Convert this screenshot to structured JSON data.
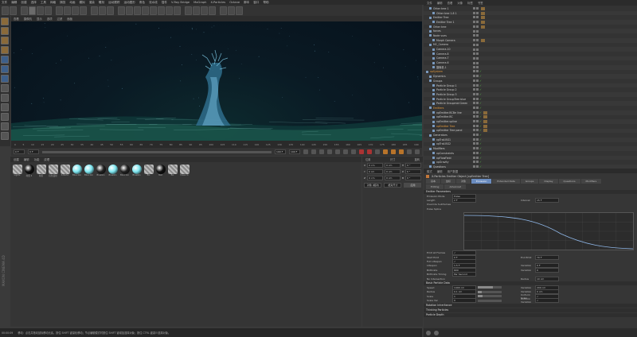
{
  "menubar": [
    "文件",
    "编辑",
    "创建",
    "选择",
    "工具",
    "网格",
    "捕捉",
    "动画",
    "模拟",
    "渲染",
    "雕刻",
    "运动跟踪",
    "运动图形",
    "角色",
    "流水线",
    "插件",
    "V-Ray Bridge",
    "MoGraph",
    "X-Particles",
    "Octane",
    "脚本",
    "窗口",
    "帮助"
  ],
  "layout_label": "界面",
  "viewport": {
    "menu": [
      "查看",
      "摄像机",
      "显示",
      "选项",
      "过滤",
      "面板"
    ]
  },
  "timeline": {
    "ticks": [
      "0",
      "5",
      "10",
      "15",
      "20",
      "25",
      "30",
      "35",
      "40",
      "45",
      "50",
      "55",
      "60",
      "65",
      "70",
      "75",
      "80",
      "85",
      "90",
      "95",
      "100",
      "105",
      "110",
      "115",
      "120",
      "125",
      "130",
      "135",
      "140",
      "145",
      "150",
      "155",
      "160",
      "165",
      "170",
      "175",
      "180",
      "185",
      "190"
    ],
    "end_label": "0 F"
  },
  "playbar": {
    "start": "0 F",
    "current": "0 F",
    "end": "190 F",
    "end2": "190 F"
  },
  "materials": {
    "menu": [
      "创建",
      "编辑",
      "功能",
      "纹理"
    ],
    "items": [
      {
        "label": "Lights",
        "color": "#9a9a9a",
        "striped": true
      },
      {
        "label": "材质 2",
        "color": "#111111",
        "striped": false
      },
      {
        "label": "材质",
        "color": "#9a9a9a",
        "striped": true
      },
      {
        "label": "红色漫射",
        "color": "#9a9a9a",
        "striped": true
      },
      {
        "label": "X-Partic",
        "color": "#9a9a9a",
        "striped": true
      },
      {
        "label": "Blue Glo",
        "color": "#7ee6f0",
        "striped": false
      },
      {
        "label": "Blue Glo",
        "color": "#7ee6f0",
        "striped": false
      },
      {
        "label": "BlueGlo",
        "color": "#222222",
        "striped": false
      },
      {
        "label": "BlueGlo",
        "color": "#7ee6f0",
        "striped": false
      },
      {
        "label": "Blue Glo",
        "color": "#222222",
        "striped": false
      },
      {
        "label": "BlueGlo",
        "color": "#7ee6f0",
        "striped": false
      },
      {
        "label": "BG",
        "color": "#9a9a9a",
        "striped": true
      },
      {
        "label": "Mat",
        "color": "#111111",
        "striped": false
      },
      {
        "label": "BG",
        "color": "#9a9a9a",
        "striped": true
      },
      {
        "label": "trees m",
        "color": "#9a9a9a",
        "striped": true
      }
    ]
  },
  "coords": {
    "headers": [
      "位置",
      "尺寸",
      "旋转"
    ],
    "rows": [
      {
        "axis": "X",
        "pos": "0 cm",
        "size": "0 cm",
        "rlabel": "H",
        "rot": "0 °"
      },
      {
        "axis": "Y",
        "pos": "0 cm",
        "size": "0 cm",
        "rlabel": "P",
        "rot": "0 °"
      },
      {
        "axis": "Z",
        "pos": "0 cm",
        "size": "0 cm",
        "rlabel": "B",
        "rot": "0 °"
      }
    ],
    "mode": "对象 (相对)",
    "size_mode": "绝对尺寸",
    "apply": "应用"
  },
  "status": {
    "time": "00:00:09",
    "message": "移动：点击并拖动鼠标移动元素。按住 SHIFT 键量化移动；节点编辑模式时按住 SHIFT 键增加选择对象；按住 CTRL 键减少选择对象。"
  },
  "maxon_label": "MAXON CINEMA 4D",
  "object_manager": {
    "menu": [
      "文件",
      "编辑",
      "查看",
      "对象",
      "标签",
      "书签"
    ],
    "rows": [
      {
        "name": "Other tree 1",
        "indent": 1,
        "check": "",
        "tag": true,
        "sel": false
      },
      {
        "name": "Other tree 1.8 1",
        "indent": 2,
        "check": "",
        "tag": true,
        "sel": false
      },
      {
        "name": "Emitter Tree",
        "indent": 1,
        "check": "",
        "tag": true,
        "sel": false
      },
      {
        "name": "Emitter Tree 1",
        "indent": 2,
        "check": "",
        "tag": true,
        "sel": false
      },
      {
        "name": "Other tree",
        "indent": 1,
        "check": "",
        "tag": true,
        "sel": false
      },
      {
        "name": "forces",
        "indent": 1,
        "check": "",
        "tag": false,
        "sel": false
      },
      {
        "name": "Node vues",
        "indent": 1,
        "check": "",
        "tag": false,
        "sel": false
      },
      {
        "name": "Morph Camera",
        "indent": 2,
        "check": "",
        "tag": true,
        "sel": false
      },
      {
        "name": "MC_Camera",
        "indent": 1,
        "check": "",
        "tag": false,
        "sel": false
      },
      {
        "name": "Camera.10",
        "indent": 2,
        "check": "",
        "tag": false,
        "sel": false
      },
      {
        "name": "Camera.8",
        "indent": 2,
        "check": "",
        "tag": false,
        "sel": false
      },
      {
        "name": "Camera.7",
        "indent": 2,
        "check": "",
        "tag": false,
        "sel": false
      },
      {
        "name": "Camera.6",
        "indent": 2,
        "check": "",
        "tag": false,
        "sel": false
      },
      {
        "name": "摄像机.1",
        "indent": 2,
        "check": "",
        "tag": false,
        "sel": false
      },
      {
        "name": "xpSystem",
        "indent": 0,
        "check": "✓",
        "tag": false,
        "sel": true
      },
      {
        "name": "Dynamics",
        "indent": 1,
        "check": "✓",
        "tag": false,
        "sel": false
      },
      {
        "name": "Groups",
        "indent": 1,
        "check": "✓",
        "tag": false,
        "sel": false
      },
      {
        "name": "Particle Group 1",
        "indent": 2,
        "check": "✓",
        "tag": false,
        "sel": false
      },
      {
        "name": "Particle Group 2",
        "indent": 2,
        "check": "✓",
        "tag": false,
        "sel": false
      },
      {
        "name": "Particle Group 3",
        "indent": 2,
        "check": "✓",
        "tag": false,
        "sel": false
      },
      {
        "name": "Particle GroupTree blue",
        "indent": 2,
        "check": "✓",
        "tag": false,
        "sel": false
      },
      {
        "name": "Particle Groupmid Green",
        "indent": 2,
        "check": "✓",
        "tag": false,
        "sel": false
      },
      {
        "name": "Emitters",
        "indent": 1,
        "check": "✓",
        "tag": false,
        "sel": true
      },
      {
        "name": "xpEmitter.BCBe line",
        "indent": 2,
        "check": "✓",
        "tag": true,
        "sel": false
      },
      {
        "name": "xpEmitter.BC",
        "indent": 2,
        "check": "✓",
        "tag": true,
        "sel": false
      },
      {
        "name": "xpEmitter.spline",
        "indent": 2,
        "check": "✓",
        "tag": true,
        "sel": false
      },
      {
        "name": "xpEmitter Tree",
        "indent": 2,
        "check": "✓",
        "tag": true,
        "sel": true
      },
      {
        "name": "xpEmitter Tree pand",
        "indent": 2,
        "check": "✓",
        "tag": true,
        "sel": false
      },
      {
        "name": "Generators",
        "indent": 1,
        "check": "✓",
        "tag": false,
        "sel": false
      },
      {
        "name": "xpTrail.BG1",
        "indent": 2,
        "check": "✓",
        "tag": false,
        "sel": false
      },
      {
        "name": "xpTrail.BG2",
        "indent": 2,
        "check": "✓",
        "tag": false,
        "sel": false
      },
      {
        "name": "Modifiers",
        "indent": 1,
        "check": "✓",
        "tag": false,
        "sel": false
      },
      {
        "name": "xpConstraints",
        "indent": 2,
        "check": "✓",
        "tag": false,
        "sel": false
      },
      {
        "name": "xpFlowField",
        "indent": 2,
        "check": "✓",
        "tag": false,
        "sel": false
      },
      {
        "name": "xpGravity",
        "indent": 2,
        "check": "✓",
        "tag": false,
        "sel": false
      },
      {
        "name": "Questions",
        "indent": 1,
        "check": "✓",
        "tag": false,
        "sel": false
      }
    ]
  },
  "attributes": {
    "menu": [
      "模式",
      "编辑",
      "用户数据"
    ],
    "title": "X-Particles Emitter Object [xpEmitter Tree]",
    "tabs": [
      "基本",
      "坐标",
      "对象",
      "Emission",
      "Extended Data",
      "Groups",
      "Display",
      "Questions",
      "Modifiers"
    ],
    "subtabs": [
      "Editing",
      "Advanced"
    ],
    "section_emission": "Emitter Parameters",
    "emission_rows": [
      {
        "label": "Emission Mode",
        "value": "Pulse"
      },
      {
        "label": "Length",
        "value": "2 F",
        "label2": "Interval",
        "value2": "15 F"
      },
      {
        "label": "Override Subframes",
        "value": ""
      },
      {
        "label": "Pulse Spline",
        "value": ""
      }
    ],
    "curve_ticks": [
      "0",
      "0.1",
      "0.2",
      "0.3",
      "0.4",
      "0.5",
      "0.6",
      "0.7",
      "0.8",
      "0.9"
    ],
    "curve_yticks": [
      "0.8",
      "0.6",
      "0.4",
      "0.2"
    ],
    "emission_rows2": [
      {
        "label": "Emit all Frames",
        "value": "✓"
      },
      {
        "label": "Start Emit",
        "value": "0 F",
        "label2": "End Emit",
        "value2": "70 F"
      },
      {
        "label": "Full Lifespan",
        "value": "✓"
      },
      {
        "label": "Lifespan",
        "value": "1.5 F",
        "label2": "Variation",
        "value2": "0 F"
      },
      {
        "label": "Birthrate",
        "value": "600",
        "label2": "Variation",
        "value2": "0"
      },
      {
        "label": "Birthrate Timing",
        "value": "Per Second"
      },
      {
        "label": "No Intersection",
        "value": "",
        "label2": "Radius",
        "value2": "10 cm"
      }
    ],
    "section_basic": "Basic Particle Data",
    "basic_rows": [
      {
        "label": "Speed",
        "value": "1400 cm",
        "label2": "Variation",
        "value2": "200 cm",
        "fill": 0.62
      },
      {
        "label": "Radius",
        "value": "0.1 cm",
        "label2": "Variation",
        "value2": "0 cm",
        "fill": 0.15
      },
      {
        "label": "Scale",
        "value": "1",
        "label2": "Uniform Scale",
        "value2": "✓",
        "fill": 0.2
      },
      {
        "label": "Scale Var",
        "value": "0",
        "label2": "Uniform Variation",
        "value2": "✓",
        "fill": 0.0
      }
    ],
    "sections_closed": [
      "Rotation Inheritance",
      "Thinking Particles",
      "Particle Depth"
    ]
  }
}
